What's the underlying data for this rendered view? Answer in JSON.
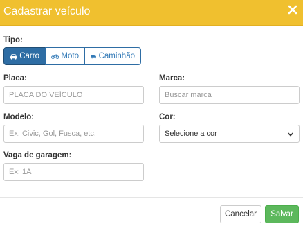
{
  "header": {
    "title": "Cadastrar veículo",
    "close_icon": "close-icon",
    "background_color": "#f0c02f"
  },
  "tipo": {
    "label": "Tipo:",
    "options": [
      {
        "label": "Carro",
        "icon": "car-icon",
        "active": true
      },
      {
        "label": "Moto",
        "icon": "motorcycle-icon",
        "active": false
      },
      {
        "label": "Caminhão",
        "icon": "truck-icon",
        "active": false
      }
    ],
    "active_color": "#2e6da4"
  },
  "placa": {
    "label": "Placa:",
    "placeholder": "PLACA DO VEÍCULO",
    "value": ""
  },
  "marca": {
    "label": "Marca:",
    "placeholder": "Buscar marca",
    "value": ""
  },
  "modelo": {
    "label": "Modelo:",
    "placeholder": "Ex: Civic, Gol, Fusca, etc.",
    "value": ""
  },
  "cor": {
    "label": "Cor:",
    "selected": "Selecione a cor"
  },
  "vaga": {
    "label": "Vaga de garagem:",
    "placeholder": "Ex: 1A",
    "value": ""
  },
  "footer": {
    "cancel_label": "Cancelar",
    "save_label": "Salvar",
    "save_color": "#5cb85c"
  }
}
